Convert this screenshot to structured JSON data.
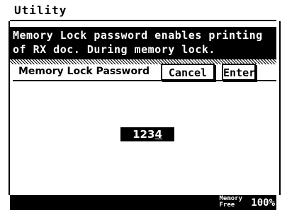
{
  "header": {
    "title": "Utility"
  },
  "message": {
    "line1": "Memory Lock password enables printing",
    "line2": "of RX doc. During memory lock."
  },
  "field": {
    "label": "Memory Lock Password"
  },
  "buttons": {
    "cancel": "Cancel",
    "enter": "Enter"
  },
  "password": {
    "value": "123",
    "cursor": "4"
  },
  "footer": {
    "memory_label_line1": "Memory",
    "memory_label_line2": "Free",
    "memory_percent": "100%"
  }
}
